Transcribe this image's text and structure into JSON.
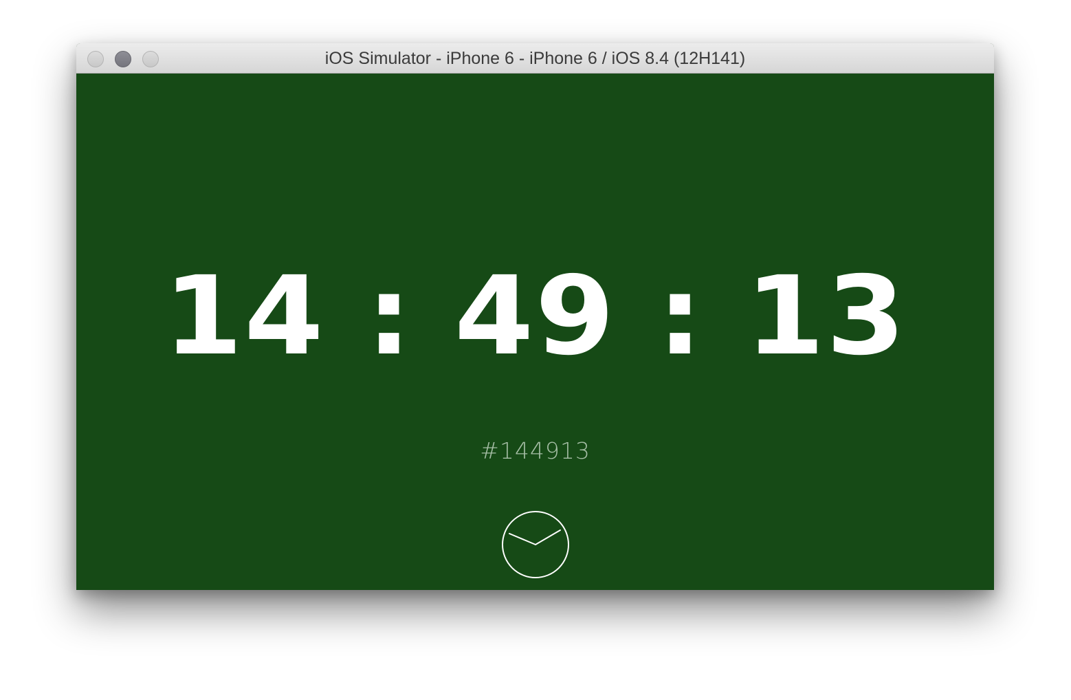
{
  "window": {
    "title": "iOS Simulator - iPhone 6 - iPhone 6 / iOS 8.4 (12H141)"
  },
  "app": {
    "time": {
      "hours": "14",
      "minutes": "49",
      "seconds": "13",
      "separator": ":"
    },
    "hex_code": "#144913",
    "background_color": "#144913",
    "text_color": "#ffffff",
    "toggle_icon": "analog-clock-icon"
  }
}
